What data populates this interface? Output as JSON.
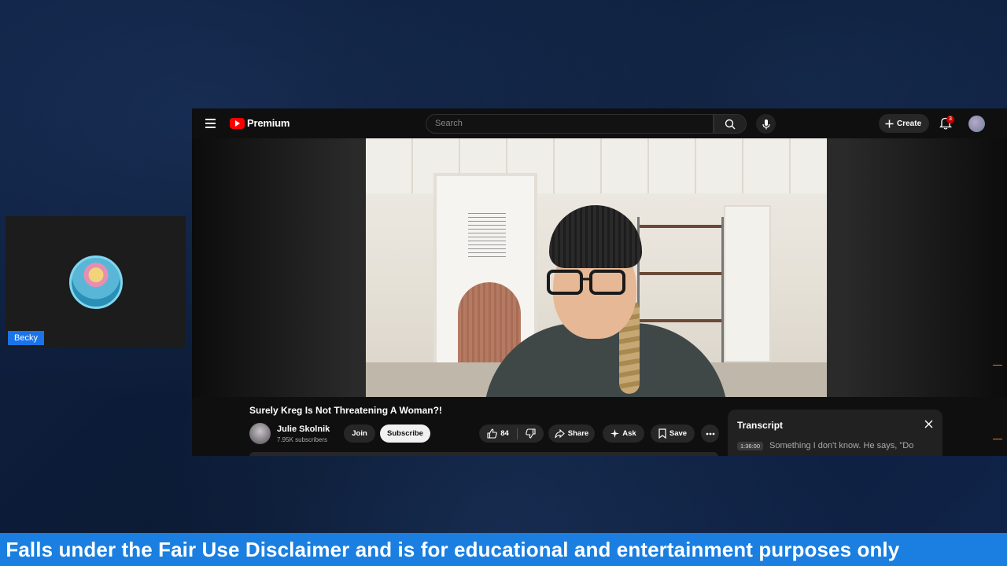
{
  "camera": {
    "name_label": "Becky"
  },
  "youtube": {
    "logo_text": "Premium",
    "search": {
      "placeholder": "Search"
    },
    "create_label": "Create",
    "notification_count": "3",
    "video": {
      "title": "Surely Kreg Is Not Threatening A Woman?!",
      "channel_name": "Julie Skolnik",
      "subscribers": "7.95K subscribers",
      "join_label": "Join",
      "subscribe_label": "Subscribe",
      "like_count": "84",
      "share_label": "Share",
      "ask_label": "Ask",
      "save_label": "Save"
    },
    "transcript": {
      "title": "Transcript",
      "timestamp": "1:36:00",
      "text": "Something I don't know. He says, \"Do"
    }
  },
  "ticker": {
    "text": "tent Falls under the Fair Use Disclaimer and is for educational and entertainment purposes only"
  },
  "colors": {
    "background": "#0e1f3b",
    "ticker": "#1a7fe0",
    "youtube_red": "#ff0000",
    "name_tag": "#1a73e8"
  }
}
